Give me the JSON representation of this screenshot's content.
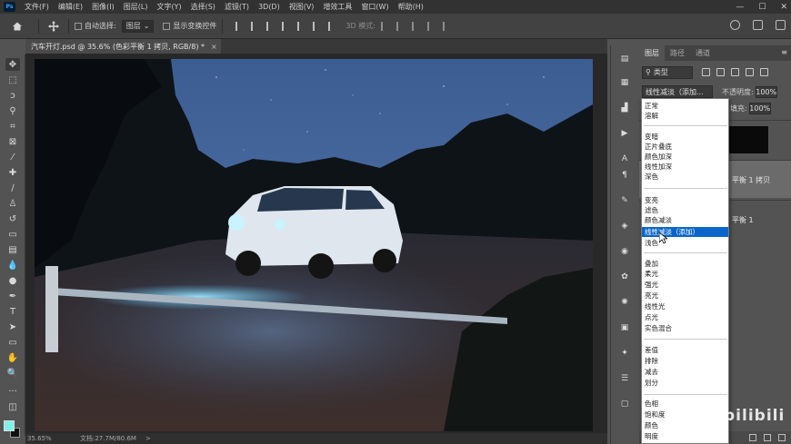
{
  "app": {
    "logo": "Ps"
  },
  "menubar": {
    "items": [
      "文件(F)",
      "编辑(E)",
      "图像(I)",
      "图层(L)",
      "文字(Y)",
      "选择(S)",
      "滤镜(T)",
      "3D(D)",
      "视图(V)",
      "增效工具",
      "窗口(W)",
      "帮助(H)"
    ]
  },
  "window_controls": {
    "minimize": "—",
    "maximize": "☐",
    "close": "✕"
  },
  "options_bar": {
    "auto_select_label": "自动选择:",
    "auto_select_value": "图层",
    "show_transform_label": "显示变换控件",
    "mode_3d_label": "3D 模式:"
  },
  "document_tab": {
    "title": "汽车开灯.psd @ 35.6% (色彩平衡 1 拷贝, RGB/8) *",
    "close": "×"
  },
  "status_bar": {
    "zoom": "35.65%",
    "doc_info": "文档:27.7M/80.6M",
    "arrow": ">"
  },
  "layers_panel": {
    "tabs": [
      "图层",
      "路径",
      "通道"
    ],
    "active_tab": "图层",
    "filter_type": "类型",
    "blend_mode_value": "线性减淡（添加...",
    "opacity_label": "不透明度:",
    "opacity_value": "100%",
    "fill_label": "填充:",
    "fill_value": "100%",
    "layers": [
      {
        "name": ""
      },
      {
        "name": "平衡 1 拷贝"
      },
      {
        "name": "平衡 1"
      }
    ]
  },
  "blend_modes": {
    "groups": [
      [
        "正常",
        "溶解"
      ],
      [
        "变暗",
        "正片叠底",
        "颜色加深",
        "线性加深",
        "深色"
      ],
      [
        "变亮",
        "滤色",
        "颜色减淡",
        "线性减淡（添加）",
        "浅色"
      ],
      [
        "叠加",
        "柔光",
        "强光",
        "亮光",
        "线性光",
        "点光",
        "实色混合"
      ],
      [
        "差值",
        "排除",
        "减去",
        "划分"
      ],
      [
        "色相",
        "饱和度",
        "颜色",
        "明度"
      ]
    ],
    "highlighted": "线性减淡（添加）"
  },
  "colors": {
    "foreground": "#7ff0e8",
    "background": "#111111",
    "highlight": "#0a67c9"
  },
  "watermark": {
    "text": "bilibili"
  }
}
